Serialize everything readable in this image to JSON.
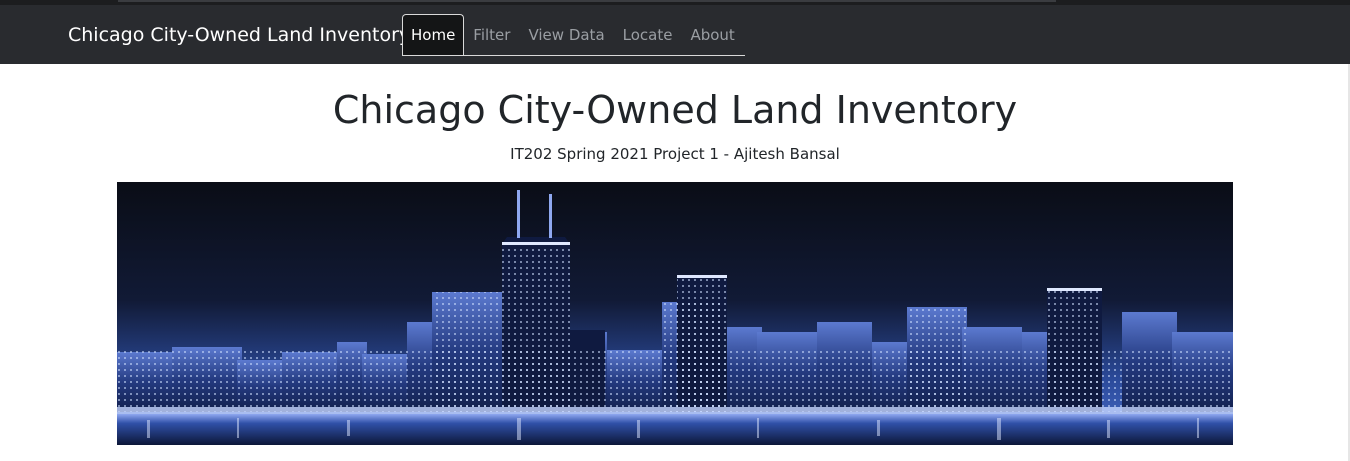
{
  "navbar": {
    "brand": "Chicago City-Owned Land Inventory",
    "items": [
      {
        "label": "Home",
        "active": true
      },
      {
        "label": "Filter",
        "active": false
      },
      {
        "label": "View Data",
        "active": false
      },
      {
        "label": "Locate",
        "active": false
      },
      {
        "label": "About",
        "active": false
      }
    ]
  },
  "hero": {
    "title": "Chicago City-Owned Land Inventory",
    "subtitle": "IT202 Spring 2021 Project 1 - Ajitesh Bansal"
  },
  "colors": {
    "navbar_bg": "#292b2f",
    "nav_inactive": "#9a9ea3",
    "nav_active_bg": "#141516",
    "text": "#212529",
    "skyline_blue": "#3c5fb8"
  },
  "banner_image": {
    "subject": "Chicago skyline at night"
  }
}
